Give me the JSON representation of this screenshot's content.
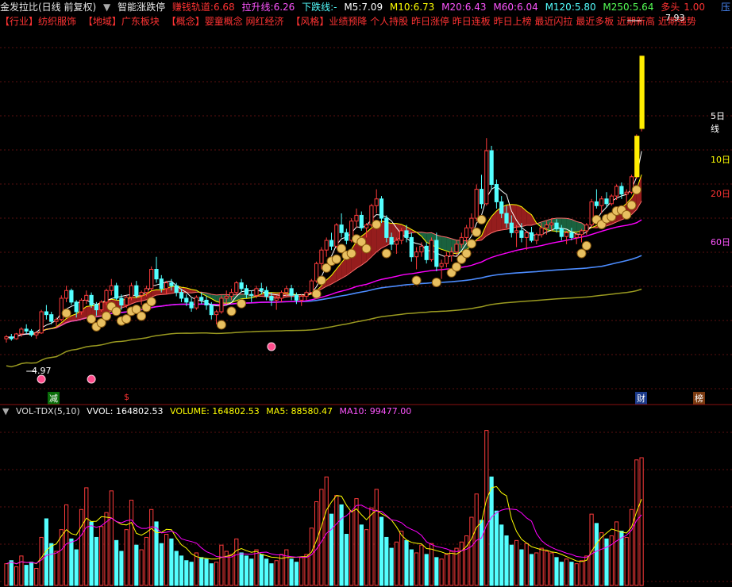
{
  "header": {
    "stock_name": "金发拉比(日线 前复权)",
    "indicator_name": "智能涨跌停",
    "earn_track_label": "赚钱轨道:",
    "earn_track_value": "6.68",
    "pull_line_label": "拉升线:",
    "pull_line_value": "6.26",
    "down_line_label": "下跌线:",
    "down_line_value": "-",
    "m5_label": "M5:",
    "m5_value": "7.09",
    "m10_label": "M10:",
    "m10_value": "6.73",
    "m20_label": "M20:",
    "m20_value": "6.43",
    "m60_label": "M60:",
    "m60_value": "6.04",
    "m120_label": "M120:",
    "m120_value": "5.80",
    "m250_label": "M250:",
    "m250_value": "5.64",
    "bull_label": "多头",
    "bull_value": "1.00",
    "corner_label": "压"
  },
  "info": {
    "industry": "【行业】纺织服饰",
    "region": "【地域】广东板块",
    "concept": "【概念】婴童概念 网红经济",
    "style": "【风格】业绩预降 个人持股 昨日涨停 昨日连板 昨日上榜 最近闪拉 最近多板 近期新高 近期强势"
  },
  "colors": {
    "up": "#ff3b3b",
    "down": "#54ffff",
    "m5": "#ffffff",
    "m10": "#ffff00",
    "m20": "#ff00ff",
    "m60": "#ff00ff",
    "m120": "#4c8cff",
    "m250": "#9a9a20"
  },
  "chart_data": [
    {
      "type": "candlestick",
      "low_label": "4.97",
      "high_label": "7.93",
      "right_labels": [
        "5日线",
        "10日",
        "20日",
        "60日"
      ],
      "bottom_markers": [
        "减",
        "$",
        "财",
        "榜"
      ],
      "ylim": [
        4.4,
        8.2
      ],
      "candles": [
        [
          5.0,
          5.04,
          4.96,
          5.02
        ],
        [
          5.02,
          5.05,
          4.98,
          5.0
        ],
        [
          5.0,
          5.06,
          4.99,
          5.05
        ],
        [
          5.05,
          5.12,
          5.02,
          5.1
        ],
        [
          5.1,
          5.15,
          5.05,
          5.08
        ],
        [
          5.08,
          5.1,
          5.02,
          5.04
        ],
        [
          5.04,
          5.08,
          5.0,
          5.06
        ],
        [
          5.06,
          5.3,
          5.05,
          5.28
        ],
        [
          5.28,
          5.35,
          5.2,
          5.25
        ],
        [
          5.25,
          5.28,
          5.15,
          5.18
        ],
        [
          5.18,
          5.22,
          5.12,
          5.2
        ],
        [
          5.2,
          5.45,
          5.18,
          5.42
        ],
        [
          5.42,
          5.55,
          5.38,
          5.5
        ],
        [
          5.5,
          5.52,
          5.35,
          5.38
        ],
        [
          5.38,
          5.4,
          5.22,
          5.28
        ],
        [
          5.28,
          5.42,
          5.25,
          5.4
        ],
        [
          5.4,
          5.5,
          5.36,
          5.45
        ],
        [
          5.45,
          5.48,
          5.32,
          5.35
        ],
        [
          5.35,
          5.38,
          5.24,
          5.3
        ],
        [
          5.3,
          5.4,
          5.28,
          5.38
        ],
        [
          5.38,
          5.52,
          5.35,
          5.5
        ],
        [
          5.5,
          5.62,
          5.45,
          5.55
        ],
        [
          5.55,
          5.58,
          5.4,
          5.42
        ],
        [
          5.42,
          5.46,
          5.3,
          5.35
        ],
        [
          5.35,
          5.45,
          5.32,
          5.43
        ],
        [
          5.43,
          5.58,
          5.4,
          5.55
        ],
        [
          5.55,
          5.6,
          5.42,
          5.45
        ],
        [
          5.45,
          5.5,
          5.35,
          5.48
        ],
        [
          5.48,
          5.55,
          5.44,
          5.52
        ],
        [
          5.52,
          5.75,
          5.5,
          5.72
        ],
        [
          5.72,
          5.85,
          5.58,
          5.62
        ],
        [
          5.62,
          5.66,
          5.48,
          5.52
        ],
        [
          5.52,
          5.6,
          5.46,
          5.58
        ],
        [
          5.58,
          5.62,
          5.5,
          5.55
        ],
        [
          5.55,
          5.58,
          5.44,
          5.48
        ],
        [
          5.48,
          5.52,
          5.38,
          5.42
        ],
        [
          5.42,
          5.46,
          5.34,
          5.38
        ],
        [
          5.38,
          5.42,
          5.28,
          5.32
        ],
        [
          5.32,
          5.45,
          5.3,
          5.43
        ],
        [
          5.43,
          5.48,
          5.36,
          5.4
        ],
        [
          5.4,
          5.44,
          5.3,
          5.35
        ],
        [
          5.35,
          5.38,
          5.2,
          5.25
        ],
        [
          5.25,
          5.3,
          5.15,
          5.28
        ],
        [
          5.28,
          5.45,
          5.26,
          5.42
        ],
        [
          5.42,
          5.5,
          5.36,
          5.44
        ],
        [
          5.44,
          5.52,
          5.4,
          5.48
        ],
        [
          5.48,
          5.6,
          5.45,
          5.58
        ],
        [
          5.58,
          5.62,
          5.48,
          5.52
        ],
        [
          5.52,
          5.56,
          5.42,
          5.46
        ],
        [
          5.46,
          5.5,
          5.38,
          5.45
        ],
        [
          5.45,
          5.55,
          5.42,
          5.52
        ],
        [
          5.52,
          5.58,
          5.46,
          5.5
        ],
        [
          5.5,
          5.54,
          5.4,
          5.44
        ],
        [
          5.44,
          5.48,
          5.34,
          5.4
        ],
        [
          5.4,
          5.45,
          5.3,
          5.42
        ],
        [
          5.42,
          5.5,
          5.38,
          5.48
        ],
        [
          5.48,
          5.55,
          5.44,
          5.52
        ],
        [
          5.52,
          5.56,
          5.4,
          5.45
        ],
        [
          5.45,
          5.48,
          5.36,
          5.4
        ],
        [
          5.4,
          5.46,
          5.34,
          5.44
        ],
        [
          5.44,
          5.5,
          5.4,
          5.48
        ],
        [
          5.48,
          5.62,
          5.46,
          5.6
        ],
        [
          5.6,
          5.8,
          5.58,
          5.78
        ],
        [
          5.78,
          5.95,
          5.72,
          5.92
        ],
        [
          5.92,
          6.05,
          5.85,
          6.02
        ],
        [
          6.02,
          6.1,
          5.92,
          5.96
        ],
        [
          5.96,
          6.2,
          5.94,
          6.18
        ],
        [
          6.18,
          6.3,
          6.05,
          6.1
        ],
        [
          6.1,
          6.14,
          5.98,
          6.02
        ],
        [
          6.02,
          6.25,
          6.0,
          6.22
        ],
        [
          6.22,
          6.35,
          6.15,
          6.28
        ],
        [
          6.28,
          6.32,
          6.12,
          6.15
        ],
        [
          6.15,
          6.2,
          6.05,
          6.18
        ],
        [
          6.18,
          6.4,
          6.16,
          6.38
        ],
        [
          6.38,
          6.55,
          6.3,
          6.45
        ],
        [
          6.45,
          6.48,
          6.2,
          6.25
        ],
        [
          6.25,
          6.28,
          6.0,
          6.05
        ],
        [
          6.05,
          6.1,
          5.92,
          5.98
        ],
        [
          5.98,
          6.05,
          5.88,
          6.02
        ],
        [
          6.02,
          6.15,
          5.98,
          6.12
        ],
        [
          6.12,
          6.18,
          6.0,
          6.05
        ],
        [
          6.05,
          6.1,
          5.8,
          5.85
        ],
        [
          5.85,
          5.95,
          5.72,
          5.9
        ],
        [
          5.9,
          6.0,
          5.85,
          5.96
        ],
        [
          5.96,
          6.0,
          5.78,
          5.82
        ],
        [
          5.82,
          6.05,
          5.8,
          6.02
        ],
        [
          6.02,
          6.1,
          5.7,
          5.75
        ],
        [
          5.75,
          5.82,
          5.62,
          5.78
        ],
        [
          5.78,
          5.9,
          5.74,
          5.86
        ],
        [
          5.86,
          5.95,
          5.8,
          5.9
        ],
        [
          5.9,
          6.02,
          5.86,
          5.98
        ],
        [
          5.98,
          6.1,
          5.94,
          6.05
        ],
        [
          6.05,
          6.18,
          6.0,
          6.15
        ],
        [
          6.15,
          6.3,
          6.1,
          6.25
        ],
        [
          6.25,
          6.6,
          6.22,
          6.55
        ],
        [
          6.55,
          6.7,
          6.35,
          6.4
        ],
        [
          6.4,
          7.08,
          6.38,
          6.95
        ],
        [
          6.95,
          7.0,
          6.55,
          6.6
        ],
        [
          6.6,
          6.65,
          6.35,
          6.42
        ],
        [
          6.42,
          6.48,
          6.25,
          6.3
        ],
        [
          6.3,
          6.38,
          6.15,
          6.2
        ],
        [
          6.2,
          6.28,
          6.05,
          6.1
        ],
        [
          6.1,
          6.18,
          5.95,
          6.12
        ],
        [
          6.12,
          6.2,
          6.0,
          6.05
        ],
        [
          6.05,
          6.12,
          5.92,
          6.1
        ],
        [
          6.1,
          6.16,
          6.0,
          6.02
        ],
        [
          6.02,
          6.1,
          5.98,
          6.08
        ],
        [
          6.08,
          6.2,
          6.05,
          6.15
        ],
        [
          6.15,
          6.22,
          6.08,
          6.18
        ],
        [
          6.18,
          6.25,
          6.12,
          6.2
        ],
        [
          6.2,
          6.24,
          6.1,
          6.14
        ],
        [
          6.14,
          6.18,
          6.02,
          6.06
        ],
        [
          6.06,
          6.12,
          5.98,
          6.1
        ],
        [
          6.1,
          6.15,
          6.02,
          6.05
        ],
        [
          6.05,
          6.1,
          5.98,
          6.08
        ],
        [
          6.08,
          6.14,
          6.0,
          6.12
        ],
        [
          6.12,
          6.2,
          6.08,
          6.18
        ],
        [
          6.18,
          6.45,
          6.16,
          6.42
        ],
        [
          6.42,
          6.55,
          6.35,
          6.38
        ],
        [
          6.38,
          6.48,
          6.3,
          6.45
        ],
        [
          6.45,
          6.52,
          6.36,
          6.4
        ],
        [
          6.4,
          6.5,
          6.38,
          6.48
        ],
        [
          6.48,
          6.6,
          6.44,
          6.58
        ],
        [
          6.58,
          6.62,
          6.45,
          6.5
        ],
        [
          6.5,
          6.55,
          6.4,
          6.52
        ],
        [
          6.52,
          6.7,
          6.5,
          6.68
        ],
        [
          6.68,
          7.12,
          6.66,
          7.1
        ],
        [
          7.18,
          7.93,
          7.15,
          7.93
        ]
      ]
    },
    {
      "type": "bar",
      "indicator": "VOL-TDX(5,10)",
      "vvol_label": "VVOL:",
      "vvol_value": "164802.53",
      "volume_label": "VOLUME:",
      "volume_value": "164802.53",
      "ma5_label": "MA5:",
      "ma5_value": "88580.47",
      "ma10_label": "MA10:",
      "ma10_value": "99477.00",
      "ylim": [
        0,
        215000
      ],
      "volumes": [
        28000,
        32000,
        24000,
        38000,
        26000,
        30000,
        22000,
        62000,
        86000,
        54000,
        44000,
        72000,
        104000,
        60000,
        46000,
        98000,
        126000,
        82000,
        62000,
        76000,
        94000,
        122000,
        58000,
        44000,
        72000,
        110000,
        52000,
        46000,
        62000,
        98000,
        82000,
        54000,
        66000,
        60000,
        44000,
        38000,
        32000,
        30000,
        42000,
        36000,
        34000,
        28000,
        30000,
        52000,
        44000,
        40000,
        60000,
        42000,
        38000,
        34000,
        46000,
        40000,
        34000,
        28000,
        32000,
        40000,
        46000,
        34000,
        30000,
        36000,
        40000,
        74000,
        108000,
        124000,
        140000,
        92000,
        116000,
        104000,
        66000,
        96000,
        112000,
        78000,
        72000,
        100000,
        124000,
        88000,
        62000,
        48000,
        56000,
        70000,
        58000,
        46000,
        42000,
        52000,
        40000,
        54000,
        36000,
        34000,
        40000,
        44000,
        48000,
        56000,
        64000,
        88000,
        118000,
        84000,
        200000,
        140000,
        96000,
        78000,
        64000,
        52000,
        58000,
        46000,
        54000,
        40000,
        42000,
        48000,
        44000,
        42000,
        36000,
        30000,
        34000,
        30000,
        28000,
        32000,
        38000,
        92000,
        80000,
        68000,
        60000,
        64000,
        82000,
        70000,
        62000,
        98000,
        162000,
        164802
      ]
    }
  ]
}
